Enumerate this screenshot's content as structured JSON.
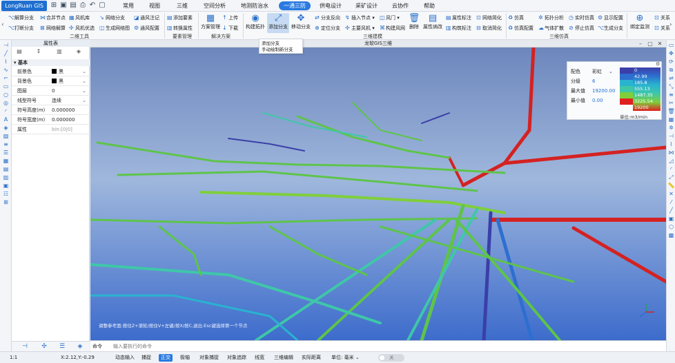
{
  "app": {
    "logo": "LongRuan GIS"
  },
  "quick_access": [
    {
      "name": "new-doc-icon",
      "glyph": "⊞"
    },
    {
      "name": "open-folder-icon",
      "glyph": "▣"
    },
    {
      "name": "save-icon",
      "glyph": "▤"
    },
    {
      "name": "print-icon",
      "glyph": "⎙"
    },
    {
      "name": "undo-icon",
      "glyph": "↶"
    },
    {
      "name": "redo-icon",
      "glyph": "▢"
    }
  ],
  "menu": [
    "常用",
    "视图",
    "三维",
    "空间分析",
    "地测防治水",
    "一通三防",
    "供电设计",
    "采矿设计",
    "云协作",
    "帮助"
  ],
  "ribbon": {
    "col1": [
      "解算分支",
      "打断分支"
    ],
    "col2": [
      "合并节点",
      "网络解算"
    ],
    "col3": [
      "风机库",
      "风机优选"
    ],
    "col4": [
      "网络分支",
      "生成网络图"
    ],
    "col5": [
      "通风注记",
      "通风配置"
    ],
    "col6": [
      "添加要素",
      "转换属性"
    ],
    "big1": "方案管理",
    "col7": [
      "上传",
      "下载"
    ],
    "big2": "构建拓扑",
    "big3": "添加分支",
    "big4": "移动分支",
    "col8": [
      "分支反向",
      "定位分支"
    ],
    "col9": [
      "插入节点",
      "主要风机"
    ],
    "col10": [
      "风门",
      "构建风网"
    ],
    "big5": "删除",
    "big6": "属性纳改",
    "col11": [
      "属性标注",
      "构筑标注"
    ],
    "col12": [
      "网络简化",
      "取消简化"
    ],
    "col13": [
      "仿真",
      "仿真配置"
    ],
    "col14": [
      "拓扑分析",
      "气体扩散"
    ],
    "col15": [
      "实时仿真",
      "停止仿真"
    ],
    "col16": [
      "显示配置",
      "生成分支"
    ],
    "big7": "绑定监测",
    "col17": [
      "关系",
      "关系"
    ],
    "groups": [
      "二维工具",
      "要素管理",
      "解决方案",
      "三维建模",
      "三维仿真"
    ]
  },
  "tooltip": {
    "title": "添加分支",
    "desc": "手动绘制新分支"
  },
  "props": {
    "title": "属性表",
    "section": "基本",
    "rows": [
      {
        "k": "前景色",
        "v": "黑"
      },
      {
        "k": "背景色",
        "v": "黑"
      },
      {
        "k": "图层",
        "v": "0"
      },
      {
        "k": "线型符号",
        "v": "连续"
      },
      {
        "k": "符号高度(m)",
        "v": "0.000000"
      },
      {
        "k": "符号宽度(m)",
        "v": "0.000000"
      },
      {
        "k": "属性",
        "v": "bin:[0|0]"
      }
    ]
  },
  "viewport": {
    "title": "龙软GIS三维",
    "hint": "调整参考面:按住Z+滚轮/按住V+左键/按X/按C,退出:Esc键选择第一个节点",
    "cmd_label": "命令",
    "cmd_placeholder": "输入要执行的命令"
  },
  "legend": {
    "color_label": "配色",
    "color_value": "彩虹",
    "level_label": "分级",
    "level_value": "6",
    "max_label": "最大值",
    "max_value": "19200.00",
    "min_label": "最小值",
    "min_value": "0.00",
    "bands": [
      {
        "value": "0",
        "color": "#3b3fa8"
      },
      {
        "value": "42.99",
        "color": "#2d6fd0"
      },
      {
        "value": "185.8",
        "color": "#29b3cf"
      },
      {
        "value": "555.13",
        "color": "#3fc7a8"
      },
      {
        "value": "1487.35",
        "color": "#7fcf3a"
      },
      {
        "value": "3225.54",
        "color": "#e02020"
      },
      {
        "value": "19200",
        "color": "#e02020"
      }
    ],
    "unit": "单位:m3/min"
  },
  "status": {
    "scale": "1:1",
    "coords": "X:2.12,Y:-0.29",
    "buttons": [
      "动态输入",
      "捕捉",
      "正交",
      "极轴",
      "对象捕捉",
      "对象追踪",
      "线宽",
      "三维编辑",
      "实际距离"
    ],
    "active": "正交",
    "unit_label": "单位: 毫米",
    "toggle": "关"
  }
}
